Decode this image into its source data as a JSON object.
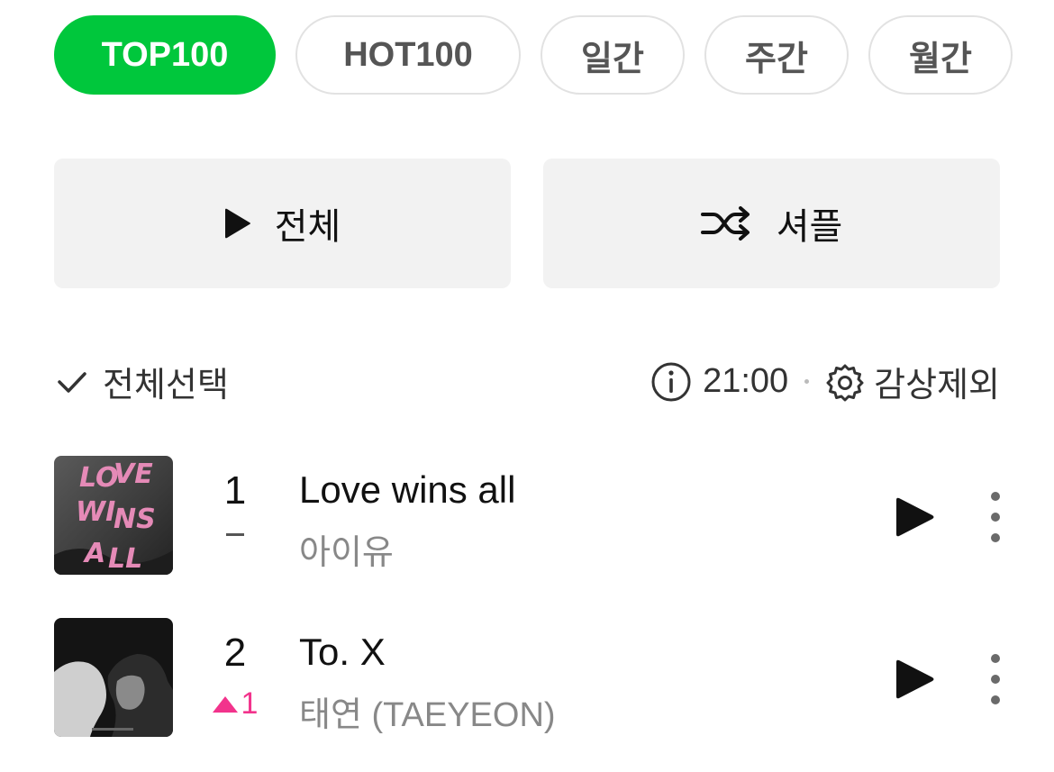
{
  "tabs": [
    {
      "label": "TOP100",
      "active": true
    },
    {
      "label": "HOT100",
      "active": false
    },
    {
      "label": "일간",
      "active": false
    },
    {
      "label": "주간",
      "active": false
    },
    {
      "label": "월간",
      "active": false
    }
  ],
  "actions": {
    "play_all_label": "전체",
    "shuffle_label": "셔플"
  },
  "toolbar": {
    "select_all_label": "전체선택",
    "time": "21:00",
    "exclude_label": "감상제외"
  },
  "songs": [
    {
      "rank": "1",
      "change": "-",
      "change_dir": "same",
      "title": "Love wins all",
      "artist": "아이유",
      "cover_text": "LOVE WINS ALL"
    },
    {
      "rank": "2",
      "change": "1",
      "change_dir": "up",
      "title": "To. X",
      "artist": "태연 (TAEYEON)"
    }
  ],
  "colors": {
    "accent": "#00c73c",
    "rank_up": "#f2338c",
    "button_bg": "#f2f2f2"
  },
  "icons": {
    "play": "play-icon",
    "shuffle": "shuffle-icon",
    "check": "check-icon",
    "info": "info-icon",
    "settings": "gear-icon",
    "more": "more-vertical-icon"
  }
}
